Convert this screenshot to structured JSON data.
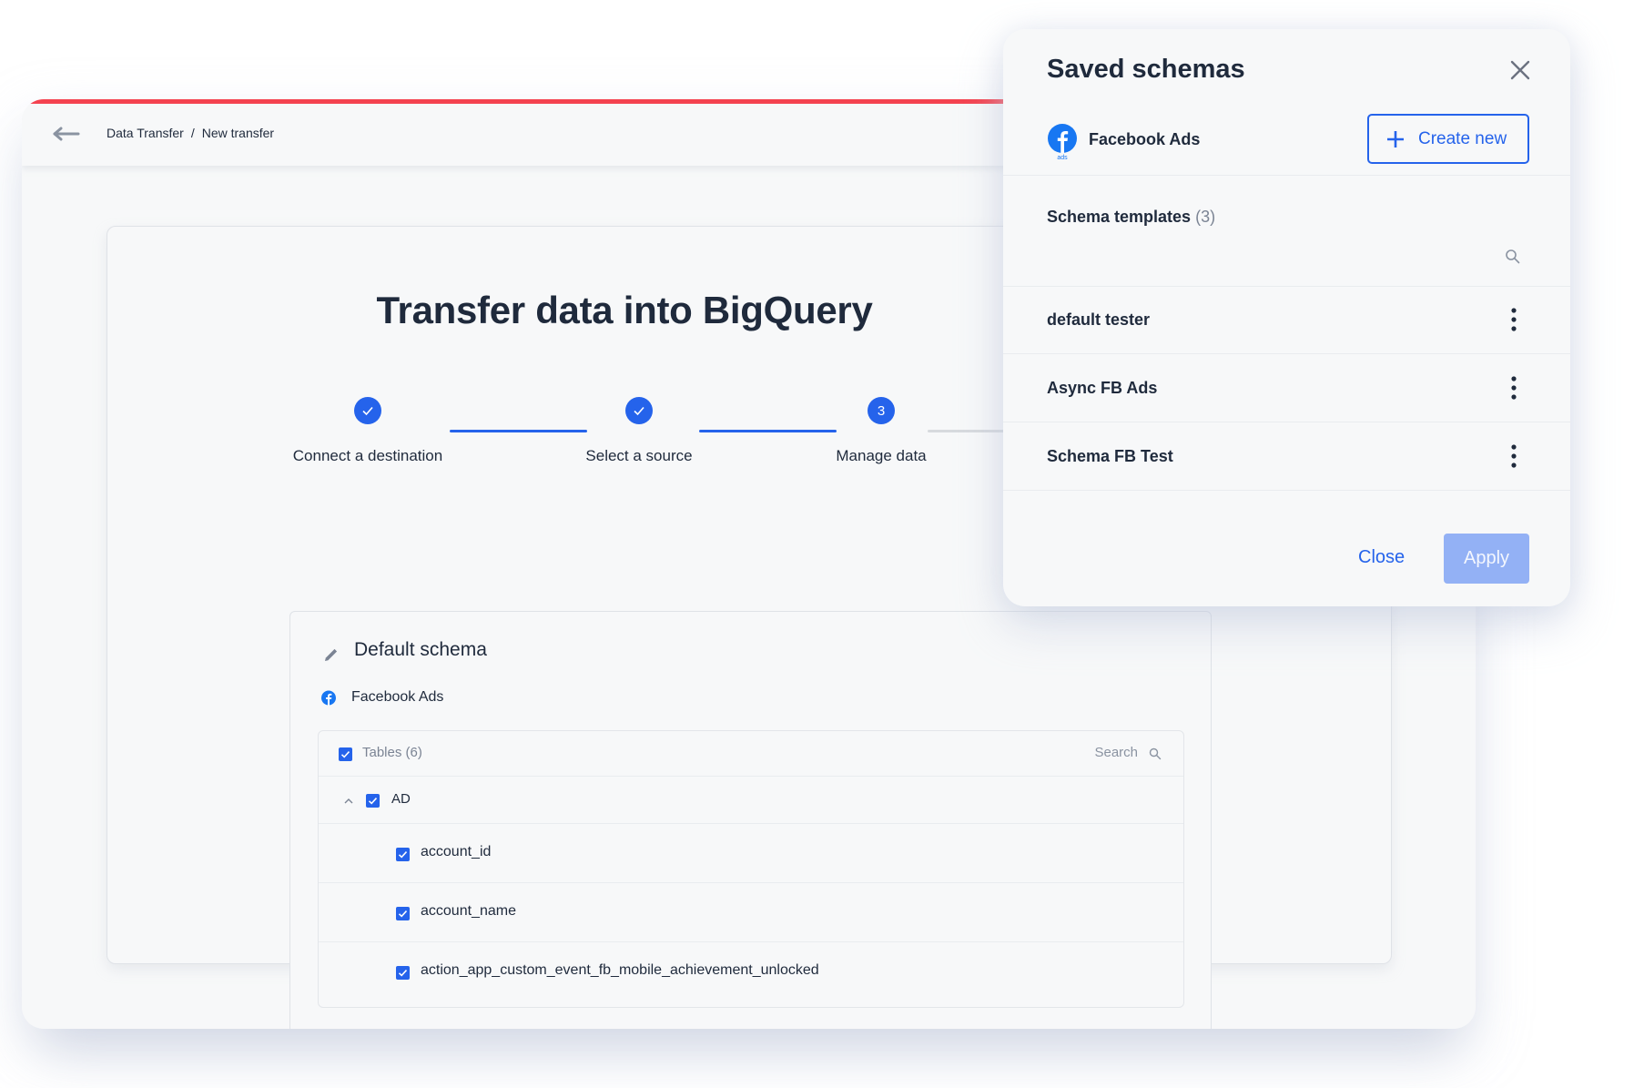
{
  "colors": {
    "accent": "#2563eb",
    "top_bar_stripe": "#f5424f",
    "apply_disabled": "#93b1f5",
    "text": "#1f2a3c",
    "muted": "#7b8494",
    "step_inactive_line": "#d7dade"
  },
  "header": {
    "back_icon": "arrow-left-icon",
    "breadcrumb": [
      "Data Transfer",
      "/",
      "New transfer"
    ]
  },
  "main": {
    "title": "Transfer data into BigQuery",
    "steps": [
      {
        "label": "Connect a destination",
        "status": "done",
        "marker": "✓"
      },
      {
        "label": "Select a source",
        "status": "done",
        "marker": "✓"
      },
      {
        "label": "Manage data",
        "status": "current",
        "marker": "3"
      }
    ],
    "schema": {
      "title": "Default schema",
      "edit_icon": "pencil-icon",
      "source": "Facebook Ads",
      "tables_header": "Tables (6)",
      "search_label": "Search",
      "tables": [
        {
          "name": "AD",
          "expanded": true,
          "checked": true,
          "fields": [
            {
              "name": "account_id",
              "checked": true
            },
            {
              "name": "account_name",
              "checked": true
            },
            {
              "name": "action_app_custom_event_fb_mobile_achievement_unlocked",
              "checked": true
            }
          ]
        }
      ]
    }
  },
  "panel": {
    "title": "Saved schemas",
    "close_icon": "close-icon",
    "source": "Facebook Ads",
    "source_icon_caption": "ads",
    "create_button": "Create new",
    "templates_heading": "Schema templates",
    "templates_count": "(3)",
    "templates": [
      {
        "name": "default tester"
      },
      {
        "name": "Async FB Ads"
      },
      {
        "name": "Schema FB Test"
      }
    ],
    "footer": {
      "close_label": "Close",
      "apply_label": "Apply",
      "apply_enabled": false
    }
  }
}
